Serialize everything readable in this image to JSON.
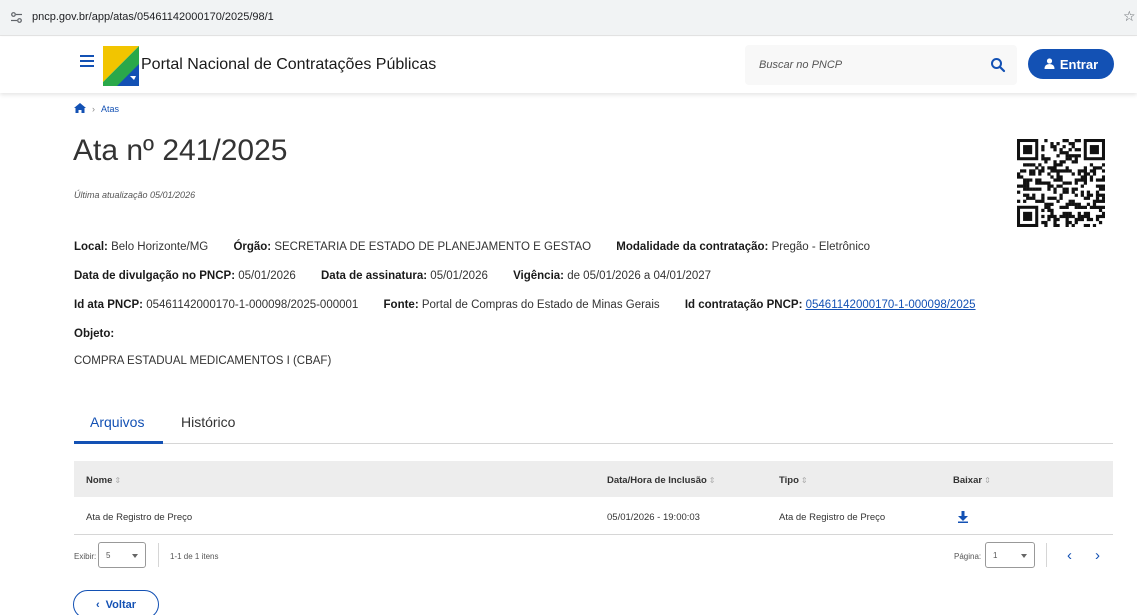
{
  "browser": {
    "url": "pncp.gov.br/app/atas/05461142000170/2025/98/1"
  },
  "header": {
    "brand": "Portal Nacional de Contratações Públicas",
    "search_placeholder": "Buscar no PNCP",
    "login_label": "Entrar"
  },
  "breadcrumb": {
    "items": [
      "Atas"
    ]
  },
  "page": {
    "title": "Ata nº 241/2025",
    "updated": "Última atualização 05/01/2026"
  },
  "details": {
    "local_label": "Local:",
    "local_value": " Belo Horizonte/MG",
    "orgao_label": "Órgão:",
    "orgao_value": " SECRETARIA DE ESTADO DE PLANEJAMENTO E GESTAO",
    "modalidade_label": "Modalidade da contratação:",
    "modalidade_value": " Pregão - Eletrônico",
    "divulgacao_label": "Data de divulgação no PNCP:",
    "divulgacao_value": " 05/01/2026",
    "assinatura_label": "Data de assinatura:",
    "assinatura_value": " 05/01/2026",
    "vigencia_label": "Vigência:",
    "vigencia_value": " de 05/01/2026 a 04/01/2027",
    "id_ata_label": "Id ata PNCP:",
    "id_ata_value": " 05461142000170-1-000098/2025-000001",
    "fonte_label": "Fonte:",
    "fonte_value": " Portal de Compras do Estado de Minas Gerais",
    "id_contratacao_label": "Id contratação PNCP:",
    "id_contratacao_value": "05461142000170-1-000098/2025",
    "objeto_label": "Objeto:",
    "objeto_value": "COMPRA ESTADUAL  MEDICAMENTOS I (CBAF)"
  },
  "tabs": [
    {
      "label": "Arquivos",
      "active": true
    },
    {
      "label": "Histórico",
      "active": false
    }
  ],
  "table": {
    "columns": [
      "Nome",
      "Data/Hora de Inclusão",
      "Tipo",
      "Baixar"
    ],
    "rows": [
      {
        "nome": "Ata de Registro de Preço",
        "data": "05/01/2026 - 19:00:03",
        "tipo": "Ata de Registro de Preço",
        "baixar": "download-icon"
      }
    ]
  },
  "pagination": {
    "show_label": "Exibir:",
    "page_size": "5",
    "range_text": "1-1 de 1 itens",
    "page_label": "Página:",
    "page_value": "1"
  },
  "footer": {
    "back_label": "Voltar"
  },
  "colors": {
    "primary": "#1351b4",
    "header_bg": "#ffffff",
    "table_head_bg": "#ededed"
  }
}
